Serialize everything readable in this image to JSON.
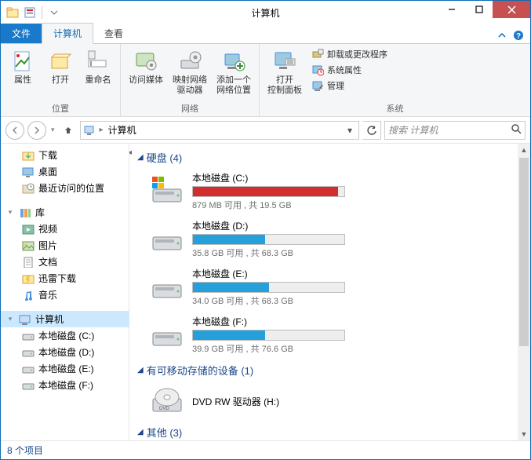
{
  "window": {
    "title": "计算机"
  },
  "tabs": {
    "file": "文件",
    "computer": "计算机",
    "view": "查看"
  },
  "ribbon": {
    "group_location": {
      "label": "位置",
      "properties": "属性",
      "open": "打开",
      "rename": "重命名"
    },
    "group_network": {
      "label": "网络",
      "access_media": "访问媒体",
      "map_drive": "映射网络\n驱动器",
      "add_location": "添加一个\n网络位置"
    },
    "group_system": {
      "label": "系统",
      "open_control": "打开\n控制面板",
      "uninstall": "卸载或更改程序",
      "sys_props": "系统属性",
      "manage": "管理"
    }
  },
  "nav": {
    "breadcrumb": "计算机",
    "search_placeholder": "搜索 计算机"
  },
  "sidebar": {
    "downloads": "下载",
    "desktop": "桌面",
    "recent": "最近访问的位置",
    "libraries": "库",
    "videos": "视频",
    "pictures": "图片",
    "documents": "文档",
    "xunlei": "迅雷下载",
    "music": "音乐",
    "computer": "计算机",
    "disk_c": "本地磁盘 (C:)",
    "disk_d": "本地磁盘 (D:)",
    "disk_e": "本地磁盘 (E:)",
    "disk_f": "本地磁盘 (F:)"
  },
  "sections": {
    "hdd": {
      "label": "硬盘 (4)",
      "count": 4
    },
    "removable": {
      "label": "有可移动存储的设备 (1)",
      "count": 1
    },
    "other": {
      "label": "其他 (3)",
      "count": 3
    }
  },
  "chart_data": [
    {
      "type": "bar",
      "title": "本地磁盘 (C:)",
      "categories": [
        "used",
        "free"
      ],
      "values": [
        18621,
        879
      ],
      "ylabel": "MB",
      "ylim": [
        0,
        19968
      ],
      "free_label": "879 MB 可用 , 共 19.5 GB",
      "color": "#d22e2e",
      "fill_pct": 95.6
    },
    {
      "type": "bar",
      "title": "本地磁盘 (D:)",
      "categories": [
        "used",
        "free"
      ],
      "values": [
        32.5,
        35.8
      ],
      "ylabel": "GB",
      "ylim": [
        0,
        68.3
      ],
      "free_label": "35.8 GB 可用 , 共 68.3 GB",
      "color": "#26a0da",
      "fill_pct": 47.6
    },
    {
      "type": "bar",
      "title": "本地磁盘 (E:)",
      "categories": [
        "used",
        "free"
      ],
      "values": [
        34.3,
        34.0
      ],
      "ylabel": "GB",
      "ylim": [
        0,
        68.3
      ],
      "free_label": "34.0 GB 可用 , 共 68.3 GB",
      "color": "#26a0da",
      "fill_pct": 50.2
    },
    {
      "type": "bar",
      "title": "本地磁盘 (F:)",
      "categories": [
        "used",
        "free"
      ],
      "values": [
        36.7,
        39.9
      ],
      "ylabel": "GB",
      "ylim": [
        0,
        76.6
      ],
      "free_label": "39.9 GB 可用 , 共 76.6 GB",
      "color": "#26a0da",
      "fill_pct": 47.9
    }
  ],
  "removable_item": {
    "name": "DVD RW 驱动器 (H:)"
  },
  "status": {
    "text": "8 个项目",
    "count": 8
  }
}
